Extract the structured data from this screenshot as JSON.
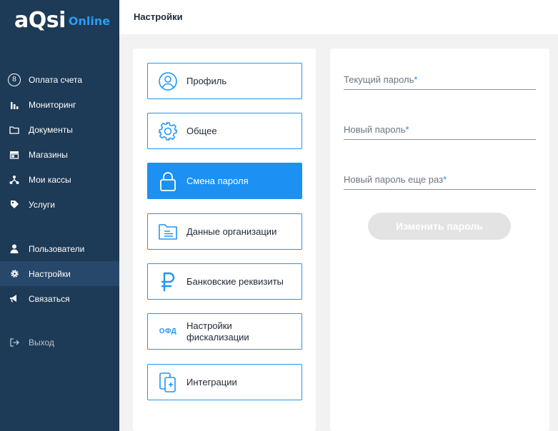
{
  "logo": {
    "brand": "aQsi",
    "accent": "Online"
  },
  "header": {
    "title": "Настройки"
  },
  "sidebar": {
    "items": [
      {
        "label": "Оплата счета",
        "badge": "8"
      },
      {
        "label": "Мониторинг"
      },
      {
        "label": "Документы"
      },
      {
        "label": "Магазины"
      },
      {
        "label": "Мои кассы"
      },
      {
        "label": "Услуги"
      },
      {
        "label": "Пользователи"
      },
      {
        "label": "Настройки"
      },
      {
        "label": "Связаться"
      },
      {
        "label": "Выход"
      }
    ]
  },
  "settings_menu": {
    "items": [
      {
        "label": "Профиль"
      },
      {
        "label": "Общее"
      },
      {
        "label": "Смена пароля"
      },
      {
        "label": "Данные организации"
      },
      {
        "label": "Банковские реквизиты"
      },
      {
        "label": "Настройки фискализации"
      },
      {
        "label": "Интеграции"
      }
    ],
    "ofd_icon_text": "ОФД"
  },
  "password_form": {
    "current_label": "Текущий пароль",
    "new_label": "Новый пароль",
    "repeat_label": "Новый пароль еще раз",
    "required_mark": "*",
    "submit_label": "Изменить пароль"
  },
  "colors": {
    "sidebar_bg": "#1d3a56",
    "accent": "#1c90f3",
    "button_disabled": "#e3e3e3"
  }
}
